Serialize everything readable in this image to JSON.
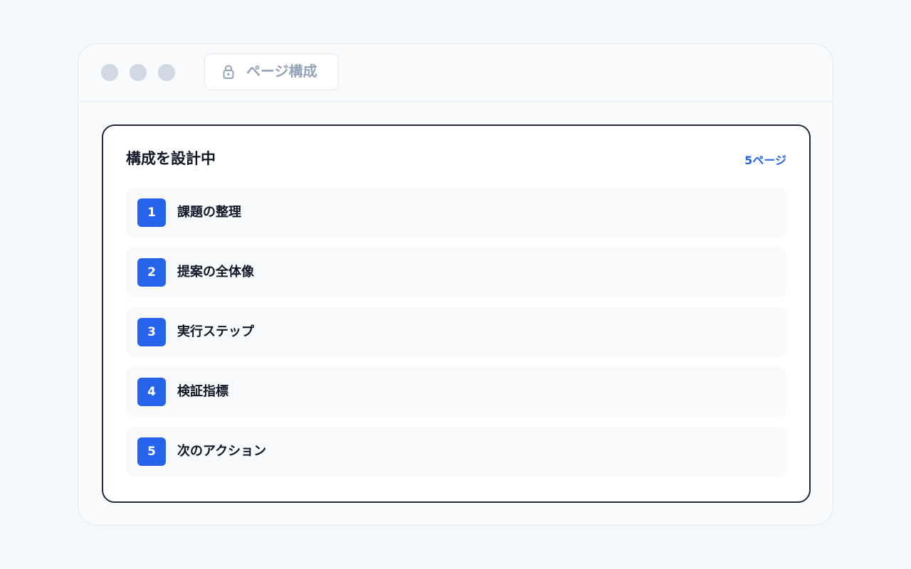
{
  "window": {
    "tab": {
      "icon": "lock-icon",
      "title": "ページ構成"
    }
  },
  "card": {
    "title": "構成を設計中",
    "page_count": "5ページ",
    "accent_color": "#2563eb",
    "items": [
      {
        "number": "1",
        "label": "課題の整理"
      },
      {
        "number": "2",
        "label": "提案の全体像"
      },
      {
        "number": "3",
        "label": "実行ステップ"
      },
      {
        "number": "4",
        "label": "検証指標"
      },
      {
        "number": "5",
        "label": "次のアクション"
      }
    ]
  }
}
